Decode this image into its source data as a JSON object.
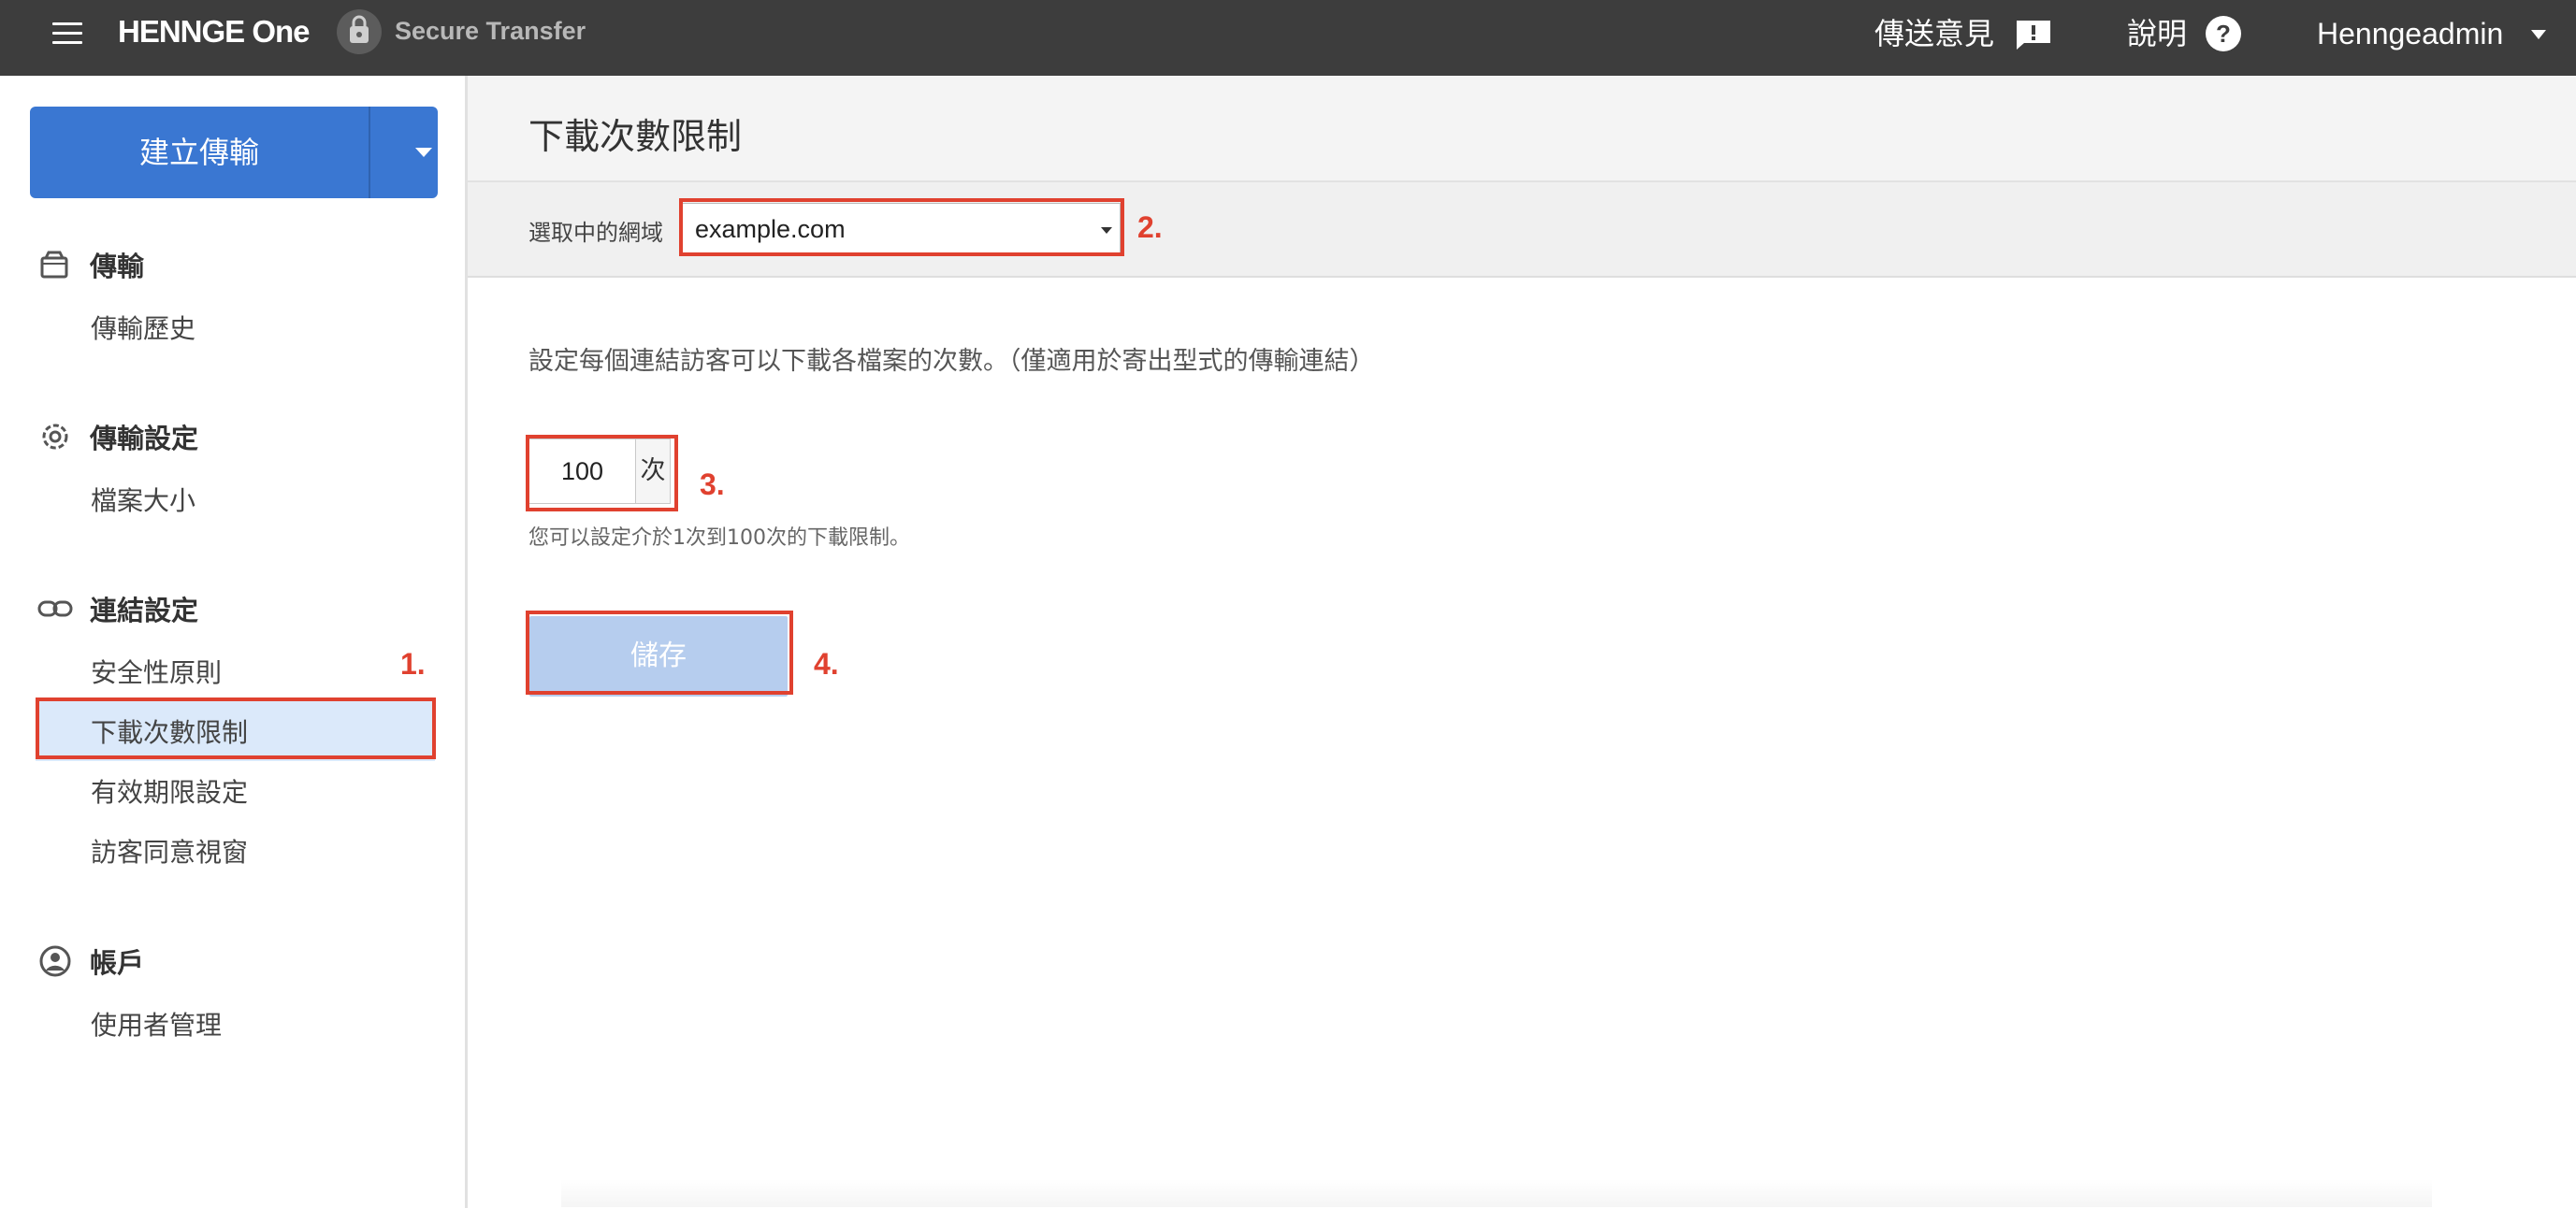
{
  "topbar": {
    "brand": "HENNGE One",
    "product": "Secure Transfer",
    "feedback_label": "傳送意見",
    "help_label": "說明",
    "user_label": "Henngeadmin",
    "icons": [
      "menu-icon",
      "feedback-icon",
      "help-icon",
      "chevron-down-icon"
    ]
  },
  "sidebar": {
    "create_button": "建立傳輸",
    "sections": [
      {
        "title": "傳輸",
        "icon": "package-icon",
        "items": [
          "傳輸歷史"
        ]
      },
      {
        "title": "傳輸設定",
        "icon": "gear-icon",
        "items": [
          "檔案大小"
        ]
      },
      {
        "title": "連結設定",
        "icon": "link-icon",
        "items": [
          "安全性原則",
          "下載次數限制",
          "有效期限設定",
          "訪客同意視窗"
        ]
      },
      {
        "title": "帳戶",
        "icon": "account-icon",
        "items": [
          "使用者管理"
        ]
      }
    ],
    "active_item": "下載次數限制"
  },
  "main": {
    "title": "下載次數限制",
    "domain_label": "選取中的網域",
    "domain_value": "example.com",
    "description": "設定每個連結訪客可以下載各檔案的次數。（僅適用於寄出型式的傳輸連結）",
    "count_value": "100",
    "count_unit": "次",
    "hint": "您可以設定介於1次到100次的下載限制。",
    "save_label": "儲存"
  },
  "annotations": [
    "1.",
    "2.",
    "3.",
    "4."
  ],
  "colors": {
    "topbar": "#3d3d3d",
    "primary": "#3a77d2",
    "active_bg": "#dbe9fa",
    "save_disabled": "#b6cdee",
    "annotation": "#e0412f"
  }
}
